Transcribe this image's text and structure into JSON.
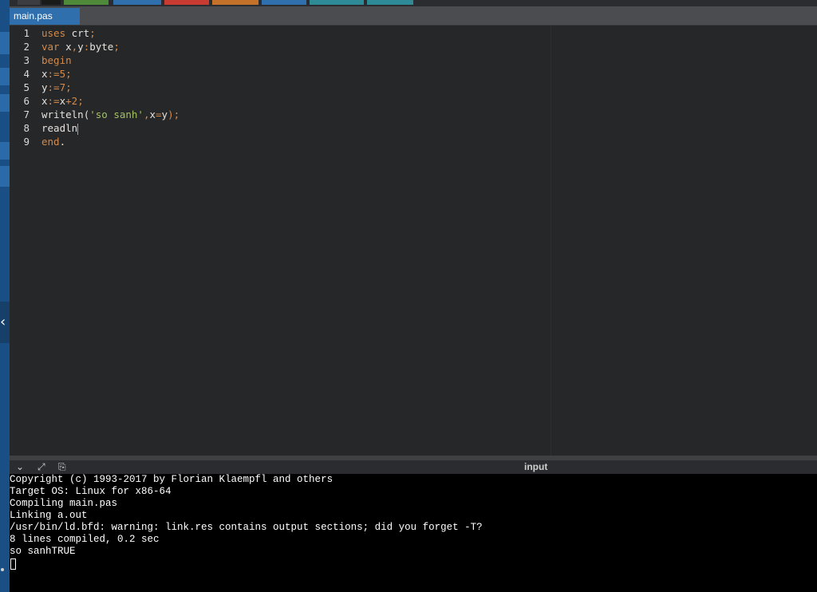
{
  "tab": {
    "filename": "main.pas"
  },
  "editor": {
    "lines": [
      {
        "n": "1",
        "parts": [
          {
            "t": "uses",
            "c": "kw"
          },
          {
            "t": " crt",
            "c": "id"
          },
          {
            "t": ";",
            "c": "op"
          }
        ]
      },
      {
        "n": "2",
        "parts": [
          {
            "t": "var",
            "c": "kw"
          },
          {
            "t": " x",
            "c": "id"
          },
          {
            "t": ",",
            "c": "op"
          },
          {
            "t": "y",
            "c": "id"
          },
          {
            "t": ":",
            "c": "op"
          },
          {
            "t": "byte",
            "c": "id"
          },
          {
            "t": ";",
            "c": "op"
          }
        ]
      },
      {
        "n": "3",
        "parts": [
          {
            "t": "begin",
            "c": "kw"
          }
        ]
      },
      {
        "n": "4",
        "parts": [
          {
            "t": "x",
            "c": "id"
          },
          {
            "t": ":=",
            "c": "op"
          },
          {
            "t": "5",
            "c": "num"
          },
          {
            "t": ";",
            "c": "op"
          }
        ]
      },
      {
        "n": "5",
        "parts": [
          {
            "t": "y",
            "c": "id"
          },
          {
            "t": ":=",
            "c": "op"
          },
          {
            "t": "7",
            "c": "num"
          },
          {
            "t": ";",
            "c": "op"
          }
        ]
      },
      {
        "n": "6",
        "parts": [
          {
            "t": "x",
            "c": "id"
          },
          {
            "t": ":=",
            "c": "op"
          },
          {
            "t": "x",
            "c": "id"
          },
          {
            "t": "+",
            "c": "op"
          },
          {
            "t": "2",
            "c": "num"
          },
          {
            "t": ";",
            "c": "op"
          }
        ]
      },
      {
        "n": "7",
        "parts": [
          {
            "t": "writeln",
            "c": "id"
          },
          {
            "t": "(",
            "c": "id"
          },
          {
            "t": "'so sanh'",
            "c": "str"
          },
          {
            "t": ",",
            "c": "op"
          },
          {
            "t": "x",
            "c": "id"
          },
          {
            "t": "=",
            "c": "op"
          },
          {
            "t": "y",
            "c": "id"
          },
          {
            "t": ");",
            "c": "op"
          }
        ]
      },
      {
        "n": "8",
        "parts": [
          {
            "t": "readln",
            "c": "id"
          }
        ],
        "cursor": true
      },
      {
        "n": "9",
        "parts": [
          {
            "t": "end",
            "c": "kw"
          },
          {
            "t": ".",
            "c": "id"
          }
        ]
      }
    ]
  },
  "output": {
    "input_label": "input",
    "icons": [
      "chevron-down-icon",
      "expand-icon",
      "clipboard-icon"
    ],
    "console_lines": [
      "Copyright (c) 1993-2017 by Florian Klaempfl and others",
      "Target OS: Linux for x86-64",
      "Compiling main.pas",
      "Linking a.out",
      "/usr/bin/ld.bfd: warning: link.res contains output sections; did you forget -T?",
      "8 lines compiled, 0.2 sec",
      "so sanhTRUE"
    ]
  },
  "colors": {
    "keyword": "#d48a4a",
    "string": "#a5c261",
    "tab_active": "#2f6fae",
    "cursor": "#7ec352"
  }
}
